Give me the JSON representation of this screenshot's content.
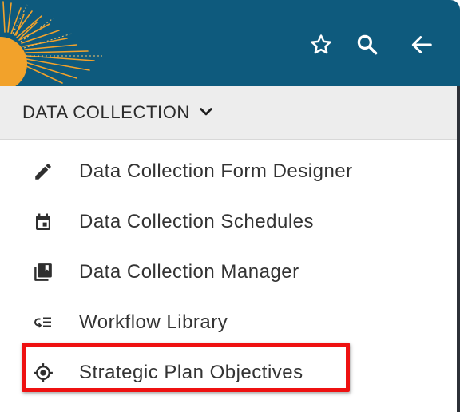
{
  "colors": {
    "header_bg": "#0e5a7d",
    "sun": "#f2a22b",
    "section_bg": "#ededed",
    "text": "#333333",
    "icon": "#2f2f2f",
    "highlight": "#ee1111"
  },
  "header": {
    "buttons": [
      {
        "name": "favorite",
        "icon": "star-outline-icon"
      },
      {
        "name": "search",
        "icon": "search-icon"
      },
      {
        "name": "back",
        "icon": "arrow-left-icon"
      }
    ]
  },
  "section": {
    "title": "DATA COLLECTION",
    "toggle_icon": "chevron-down-icon"
  },
  "menu": {
    "items": [
      {
        "label": "Data Collection Form Designer",
        "icon": "pencil-icon"
      },
      {
        "label": "Data Collection Schedules",
        "icon": "calendar-icon"
      },
      {
        "label": "Data Collection Manager",
        "icon": "library-books-icon"
      },
      {
        "label": "Workflow Library",
        "icon": "workflow-list-icon"
      },
      {
        "label": "Strategic Plan Objectives",
        "icon": "target-icon",
        "highlighted": true
      }
    ]
  }
}
